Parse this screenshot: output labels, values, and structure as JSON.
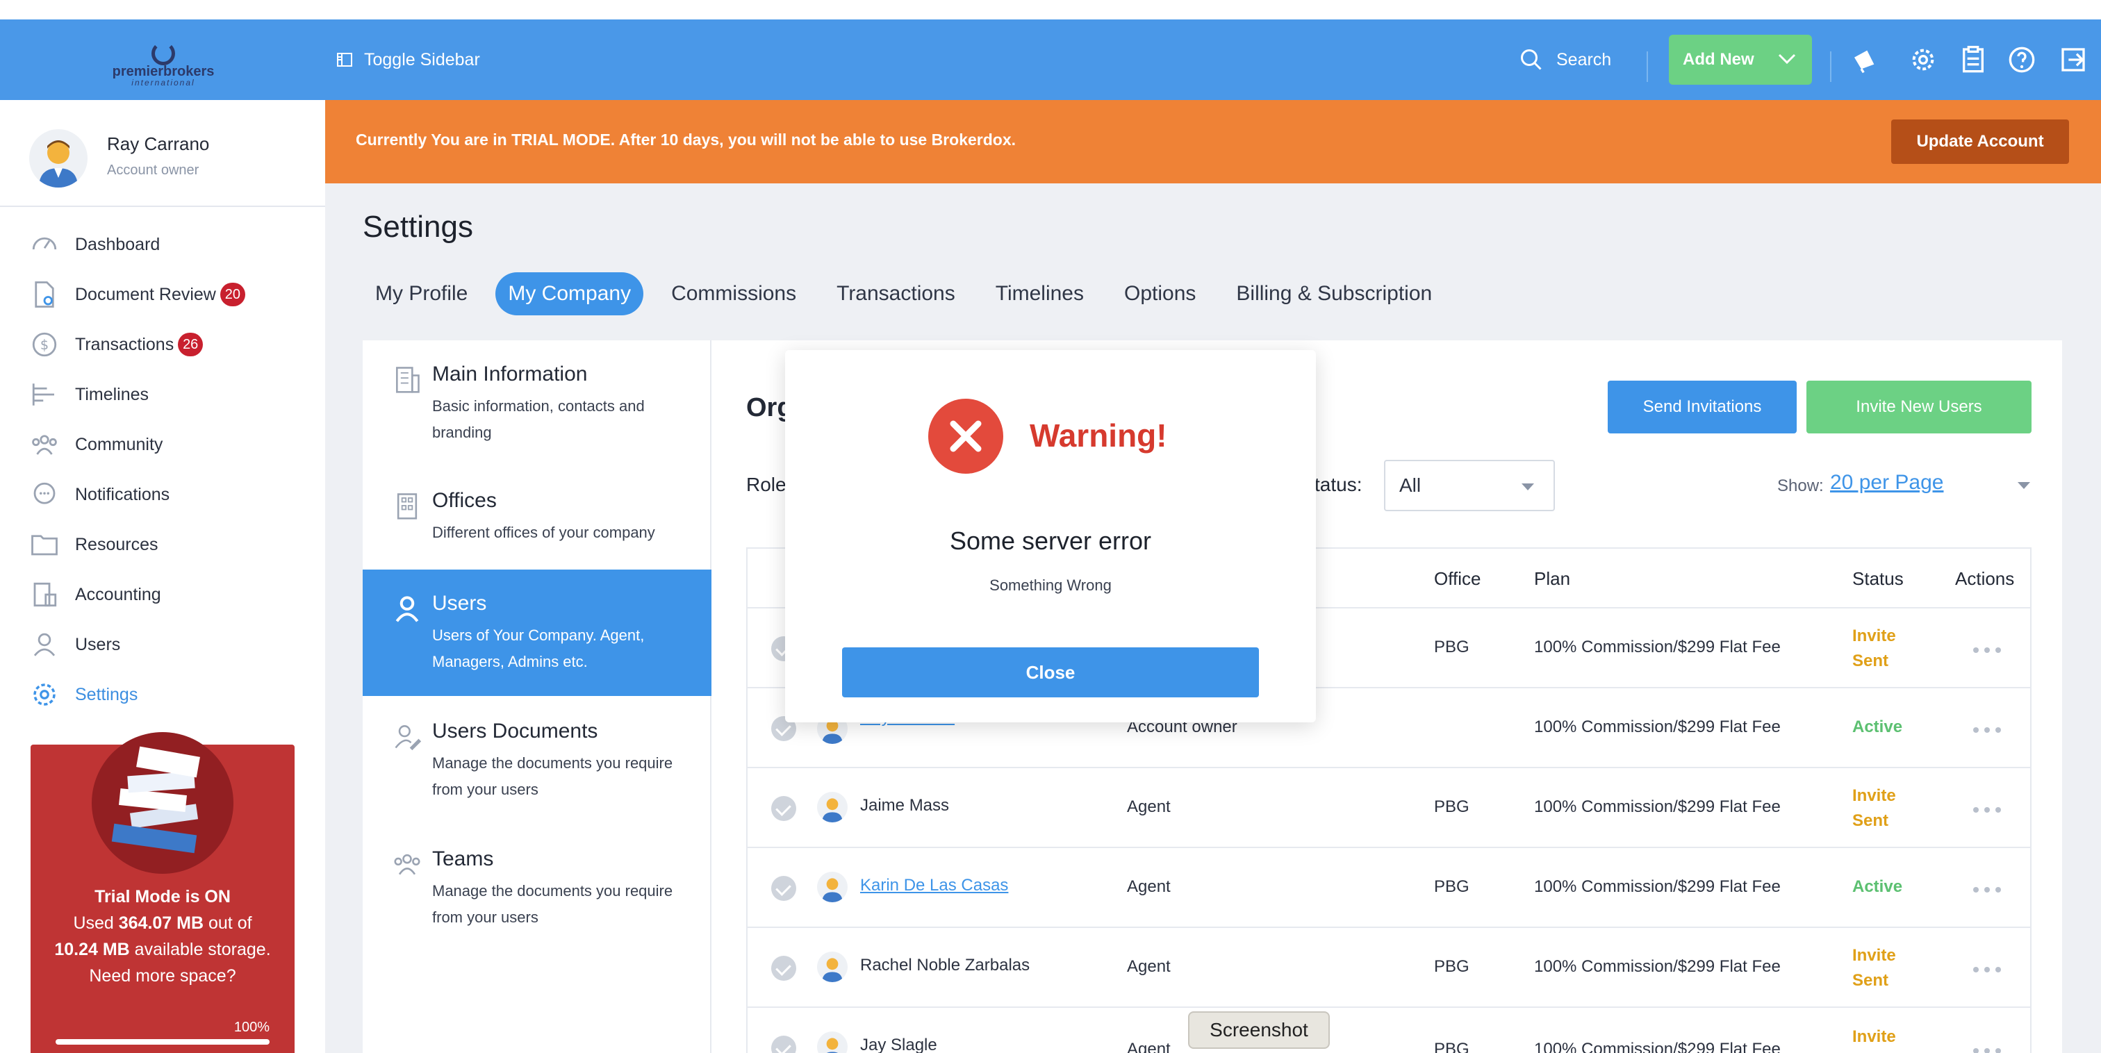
{
  "header": {
    "logo_text": "premierbrokers",
    "logo_sub": "international",
    "toggle_label": "Toggle Sidebar",
    "search_label": "Search",
    "add_new_label": "Add New"
  },
  "profile": {
    "name": "Ray Carrano",
    "role": "Account owner"
  },
  "sidebar": {
    "items": [
      {
        "label": "Dashboard",
        "icon": "dashboard-icon",
        "badge": ""
      },
      {
        "label": "Document Review",
        "icon": "document-review-icon",
        "badge": "20"
      },
      {
        "label": "Transactions",
        "icon": "dollar-icon",
        "badge": "26"
      },
      {
        "label": "Timelines",
        "icon": "timeline-icon",
        "badge": ""
      },
      {
        "label": "Community",
        "icon": "community-icon",
        "badge": ""
      },
      {
        "label": "Notifications",
        "icon": "chat-icon",
        "badge": ""
      },
      {
        "label": "Resources",
        "icon": "folder-icon",
        "badge": ""
      },
      {
        "label": "Accounting",
        "icon": "accounting-icon",
        "badge": ""
      },
      {
        "label": "Users",
        "icon": "user-icon",
        "badge": ""
      },
      {
        "label": "Settings",
        "icon": "gear-icon",
        "badge": ""
      }
    ]
  },
  "trial": {
    "title": "Trial Mode is ON",
    "used_prefix": "Used ",
    "used_value": "364.07 MB",
    "out_of": " out of",
    "avail_value": "10.24 MB",
    "avail_suffix": " available storage.",
    "more": "Need more space?",
    "percent_label": "100%",
    "percent": 100
  },
  "banner": {
    "text": "Currently You are in TRIAL MODE. After 10 days, you will not be able to use Brokerdox.",
    "button": "Update Account"
  },
  "page": {
    "title": "Settings",
    "tabs": [
      "My Profile",
      "My Company",
      "Commissions",
      "Transactions",
      "Timelines",
      "Options",
      "Billing & Subscription"
    ]
  },
  "subnav": [
    {
      "title": "Main Information",
      "desc": "Basic information, contacts and branding"
    },
    {
      "title": "Offices",
      "desc": "Different offices of your company"
    },
    {
      "title": "Users",
      "desc": "Users of Your Company. Agent, Managers, Admins etc."
    },
    {
      "title": "Users Documents",
      "desc": "Manage the documents you require from your users"
    },
    {
      "title": "Teams",
      "desc": "Manage the documents you require from your users"
    }
  ],
  "content": {
    "title": "Org",
    "send_invitations": "Send Invitations",
    "invite_new_users": "Invite New Users",
    "role_label": "Role",
    "status_label": "tatus:",
    "status_value": "All",
    "show_label": "Show:",
    "show_value": "20 per Page"
  },
  "table": {
    "headers": {
      "office": "Office",
      "plan": "Plan",
      "status": "Status",
      "actions": "Actions"
    },
    "rows": [
      {
        "name": "",
        "role": "",
        "office": "PBG",
        "plan": "100% Commission/$299 Flat Fee",
        "status1": "Invite",
        "status2": "Sent"
      },
      {
        "name": "Ray Carrano",
        "role": "Account owner",
        "office": "",
        "plan": "100% Commission/$299 Flat Fee",
        "status1": "Active",
        "status2": ""
      },
      {
        "name": "Jaime Mass",
        "role": "Agent",
        "office": "PBG",
        "plan": "100% Commission/$299 Flat Fee",
        "status1": "Invite",
        "status2": "Sent"
      },
      {
        "name": "Karin De Las Casas",
        "role": "Agent",
        "office": "PBG",
        "plan": "100% Commission/$299 Flat Fee",
        "status1": "Active",
        "status2": ""
      },
      {
        "name": "Rachel Noble Zarbalas",
        "role": "Agent",
        "office": "PBG",
        "plan": "100% Commission/$299 Flat Fee",
        "status1": "Invite",
        "status2": "Sent"
      },
      {
        "name": "Jay Slagle",
        "role": "Agent",
        "office": "PBG",
        "plan": "100% Commission/$299 Flat Fee",
        "status1": "Invite",
        "status2": ""
      }
    ]
  },
  "modal": {
    "title": "Warning!",
    "message": "Some server error",
    "detail": "Something Wrong",
    "close": "Close"
  },
  "tooltip": "Screenshot",
  "colors": {
    "primary": "#4a98e8",
    "banner": "#ef8236",
    "success": "#6cd184",
    "danger": "#bf3434"
  }
}
